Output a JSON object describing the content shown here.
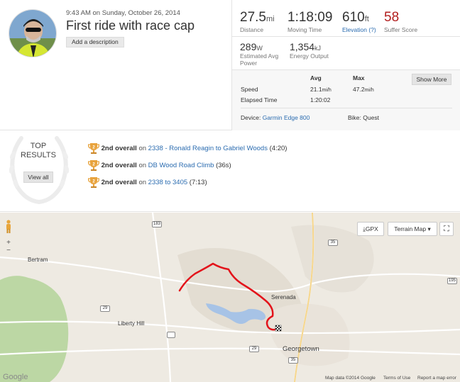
{
  "activity": {
    "date_text": "9:43 AM on Sunday, October 26, 2014",
    "title": "First ride with race cap",
    "add_description": "Add a description"
  },
  "stats": {
    "distance": {
      "value": "27.5",
      "unit": "mi",
      "label": "Distance"
    },
    "moving_time": {
      "value": "1:18:09",
      "label": "Moving Time"
    },
    "elevation": {
      "value": "610",
      "unit": "ft",
      "label": "Elevation (?)"
    },
    "suffer_score": {
      "value": "58",
      "label": "Suffer Score"
    },
    "power": {
      "value": "289",
      "unit": "W",
      "label": "Estimated Avg Power"
    },
    "energy": {
      "value": "1,354",
      "unit": "kJ",
      "label": "Energy Output"
    }
  },
  "details": {
    "avg_header": "Avg",
    "max_header": "Max",
    "show_more": "Show More",
    "speed_label": "Speed",
    "speed_avg": "21.1",
    "speed_max": "47.2",
    "speed_unit": "mi/h",
    "elapsed_label": "Elapsed Time",
    "elapsed_value": "1:20:02",
    "device_label": "Device:",
    "device_name": "Garmin Edge 800",
    "bike_text": "Bike: Quest"
  },
  "top_results": {
    "title_line1": "TOP",
    "title_line2": "RESULTS",
    "view_all": "View all",
    "items": [
      {
        "badge": "2",
        "rank": "2nd overall",
        "on": "on",
        "segment": "2338 - Ronald Reagin to Gabriel Woods",
        "time": "(4:20)"
      },
      {
        "badge": "2",
        "rank": "2nd overall",
        "on": "on",
        "segment": "DB Wood Road Climb",
        "time": "(36s)"
      },
      {
        "badge": "2",
        "rank": "2nd overall",
        "on": "on",
        "segment": "2338 to 3405",
        "time": "(7:13)"
      }
    ]
  },
  "map": {
    "gpx_label": "GPX",
    "map_type": "Terrain Map",
    "towns": {
      "bertram": "Bertram",
      "liberty_hill": "Liberty Hill",
      "serenada": "Serenada",
      "georgetown": "Georgetown"
    },
    "shields": {
      "us183": "183",
      "us29a": "29",
      "us29b": "29",
      "i35a": "35",
      "i35b": "35",
      "r195": "195",
      "r2338": ""
    },
    "google": "Google",
    "attribution": {
      "map_data": "Map data ©2014 Google",
      "terms": "Terms of Use",
      "report": "Report a map error"
    }
  },
  "colors": {
    "link": "#2b6cb0",
    "suffer": "#b21e1e",
    "route": "#e3131b",
    "trophy": "#e8a33d",
    "lake": "#a7c3e6",
    "park": "#bcd7a4"
  }
}
